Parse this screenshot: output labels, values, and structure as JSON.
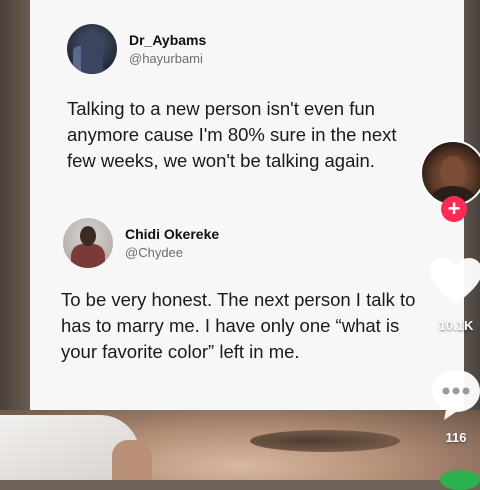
{
  "tweet1": {
    "username": "Dr_Aybams",
    "handle": "@hayurbami",
    "text": "Talking to a new person isn't even fun anymore cause I'm 80% sure in the next few weeks, we won't be talking again."
  },
  "tweet2": {
    "username": "Chidi Okereke",
    "handle": "@Chydee",
    "text": "To be very honest. The next person I talk to has to marry me. I have only one “what is your favorite color” left in me."
  },
  "sidebar": {
    "follow_label": "+",
    "likes": "10.1K",
    "comments": "116"
  },
  "colors": {
    "follow": "#fe2c55",
    "card": "#f7f7f7"
  },
  "icons": [
    "heart-icon",
    "comment-icon",
    "plus-icon",
    "share-icon"
  ]
}
